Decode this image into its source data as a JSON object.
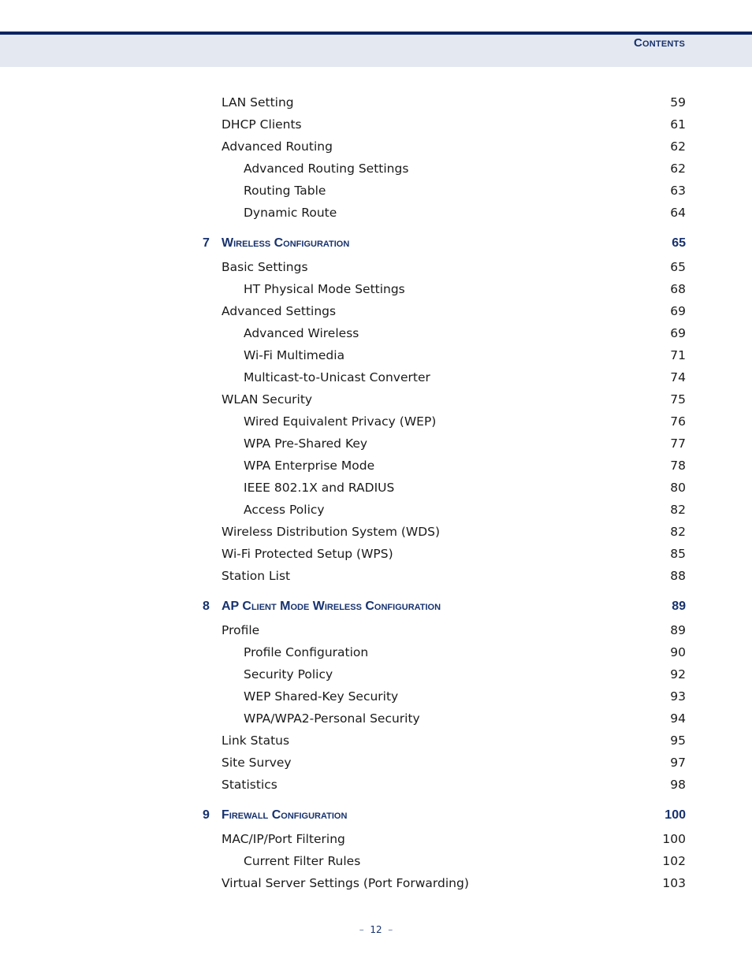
{
  "header": {
    "title": "Contents"
  },
  "toc": [
    {
      "type": "l1",
      "label": "LAN Setting",
      "page": "59"
    },
    {
      "type": "l1",
      "label": "DHCP Clients",
      "page": "61"
    },
    {
      "type": "l1",
      "label": "Advanced Routing",
      "page": "62"
    },
    {
      "type": "l2",
      "label": "Advanced Routing Settings",
      "page": "62"
    },
    {
      "type": "l2",
      "label": "Routing Table",
      "page": "63"
    },
    {
      "type": "l2",
      "label": "Dynamic Route",
      "page": "64"
    },
    {
      "type": "chapter",
      "num": "7",
      "label": "Wireless Configuration",
      "page": "65"
    },
    {
      "type": "l1",
      "label": "Basic Settings",
      "page": "65"
    },
    {
      "type": "l2",
      "label": "HT Physical Mode Settings",
      "page": "68"
    },
    {
      "type": "l1",
      "label": "Advanced Settings",
      "page": "69"
    },
    {
      "type": "l2",
      "label": "Advanced Wireless",
      "page": "69"
    },
    {
      "type": "l2",
      "label": "Wi-Fi Multimedia",
      "page": "71"
    },
    {
      "type": "l2",
      "label": "Multicast-to-Unicast Converter",
      "page": "74"
    },
    {
      "type": "l1",
      "label": "WLAN Security",
      "page": "75"
    },
    {
      "type": "l2",
      "label": "Wired Equivalent Privacy (WEP)",
      "page": "76"
    },
    {
      "type": "l2",
      "label": "WPA Pre-Shared Key",
      "page": "77"
    },
    {
      "type": "l2",
      "label": "WPA Enterprise Mode",
      "page": "78"
    },
    {
      "type": "l2",
      "label": "IEEE 802.1X and RADIUS",
      "page": "80"
    },
    {
      "type": "l2",
      "label": "Access Policy",
      "page": "82"
    },
    {
      "type": "l1",
      "label": "Wireless Distribution System (WDS)",
      "page": "82"
    },
    {
      "type": "l1",
      "label": "Wi-Fi Protected Setup (WPS)",
      "page": "85"
    },
    {
      "type": "l1",
      "label": "Station List",
      "page": "88"
    },
    {
      "type": "chapter",
      "num": "8",
      "label": "AP Client Mode Wireless Configuration",
      "page": "89"
    },
    {
      "type": "l1",
      "label": "Profile",
      "page": "89"
    },
    {
      "type": "l2",
      "label": "Profile Configuration",
      "page": "90"
    },
    {
      "type": "l2",
      "label": "Security Policy",
      "page": "92"
    },
    {
      "type": "l2",
      "label": "WEP Shared-Key Security",
      "page": "93"
    },
    {
      "type": "l2",
      "label": "WPA/WPA2-Personal Security",
      "page": "94"
    },
    {
      "type": "l1",
      "label": "Link Status",
      "page": "95"
    },
    {
      "type": "l1",
      "label": "Site Survey",
      "page": "97"
    },
    {
      "type": "l1",
      "label": "Statistics",
      "page": "98"
    },
    {
      "type": "chapter",
      "num": "9",
      "label": "Firewall Configuration",
      "page": "100"
    },
    {
      "type": "l1",
      "label": "MAC/IP/Port Filtering",
      "page": "100"
    },
    {
      "type": "l2",
      "label": "Current Filter Rules",
      "page": "102"
    },
    {
      "type": "l1",
      "label": "Virtual Server Settings (Port Forwarding)",
      "page": "103"
    }
  ],
  "footer": {
    "dash": "–",
    "page_number": "12"
  }
}
